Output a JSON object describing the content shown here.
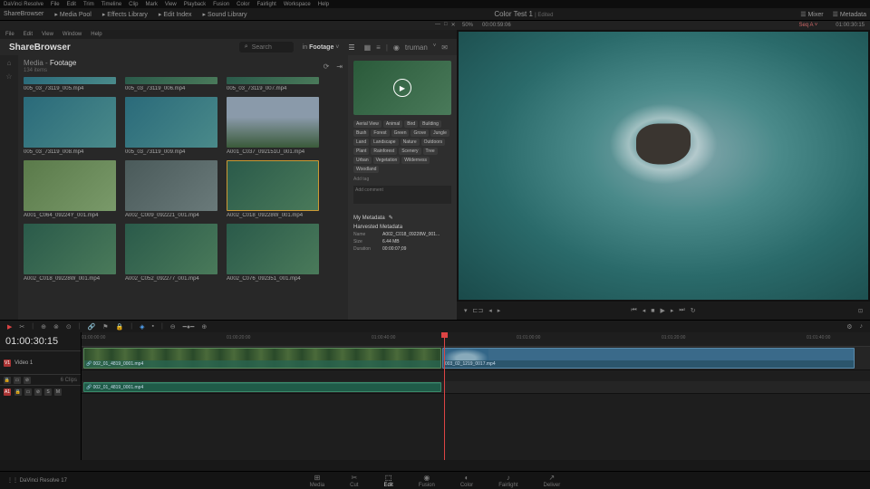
{
  "topmenu": [
    "DaVinci Resolve",
    "File",
    "Edit",
    "Trim",
    "Timeline",
    "Clip",
    "Mark",
    "View",
    "Playback",
    "Fusion",
    "Color",
    "Fairlight",
    "Workspace",
    "Help"
  ],
  "appbar": {
    "left": [
      "ShareBrowser",
      "Media Pool",
      "Effects Library",
      "Edit Index",
      "Sound Library"
    ],
    "center": "Color Test 1",
    "center_status": "Edited",
    "right": [
      "Mixer",
      "Metadata"
    ]
  },
  "infobar": {
    "zoom": "50%",
    "time": "00:00:59:06",
    "seq": "Seq A",
    "dur": "01:00:30:15"
  },
  "sb": {
    "menu": [
      "File",
      "Edit",
      "View",
      "Window",
      "Help"
    ],
    "title": "ShareBrowser",
    "search_ph": "Search",
    "in_label": "in",
    "in_value": "Footage",
    "user": "truman",
    "crumb_root": "Media",
    "crumb_leaf": "Footage",
    "count": "134 items",
    "thumbs": [
      {
        "name": "005_03_73119_005.mp4",
        "cls": "ocean short"
      },
      {
        "name": "005_03_73119_006.mp4",
        "cls": "short"
      },
      {
        "name": "005_03_73119_007.mp4",
        "cls": "short"
      },
      {
        "name": "005_03_73119_008.mp4",
        "cls": "ocean"
      },
      {
        "name": "005_03_73119_009.mp4",
        "cls": "ocean"
      },
      {
        "name": "A001_C037_092151U_001.mp4",
        "cls": "cross"
      },
      {
        "name": "A001_C064_09224Y_001.mp4",
        "cls": "field"
      },
      {
        "name": "A002_C009_092221_001.mp4",
        "cls": "town"
      },
      {
        "name": "A002_C018_09228W_001.mp4",
        "cls": "sel"
      },
      {
        "name": "A002_C018_09228W_001.mp4",
        "cls": ""
      },
      {
        "name": "A002_C052_092277_001.mp4",
        "cls": ""
      },
      {
        "name": "A002_C076_092351_001.mp4",
        "cls": ""
      }
    ],
    "tags": [
      "Aerial View",
      "Animal",
      "Bird",
      "Building",
      "Bush",
      "Forest",
      "Green",
      "Grove",
      "Jungle",
      "Land",
      "Landscape",
      "Nature",
      "Outdoors",
      "Plant",
      "Rainforest",
      "Scenery",
      "Tree",
      "Urban",
      "Vegetation",
      "Wilderness",
      "Woodland"
    ],
    "addtag": "Add tag",
    "comment_ph": "Add comment",
    "my_meta": "My Metadata",
    "harv_meta": "Harvested Metadata",
    "meta": {
      "Name": "A002_C018_09228W_001...",
      "Size": "6.44 MB",
      "Duration": "00:00:07;09"
    }
  },
  "viewer": {
    "tc": ""
  },
  "timeline": {
    "tc": "01:00:30:15",
    "marks": [
      "01:00:00:00",
      "01:00:20:00",
      "01:00:40:00",
      "01:01:00:00",
      "01:01:20:00",
      "01:01:40:00"
    ],
    "v1": "Video 1",
    "a1": "A1",
    "clip1": "002_01_4819_0001.mp4",
    "clip2": "003_02_1219_0017.mp4",
    "aclip": "002_01_4819_0001.mp4"
  },
  "pages": [
    "Media",
    "Cut",
    "Edit",
    "Fusion",
    "Color",
    "Fairlight",
    "Deliver"
  ],
  "active_page": "Edit",
  "version": "DaVinci Resolve 17"
}
